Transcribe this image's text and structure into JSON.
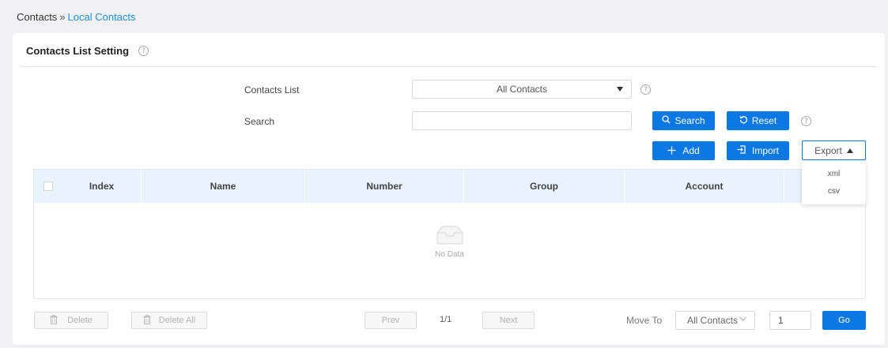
{
  "breadcrumb": {
    "parent": "Contacts",
    "separator": "»",
    "current": "Local Contacts"
  },
  "card": {
    "title": "Contacts List Setting"
  },
  "help_glyph": "?",
  "form": {
    "contacts_list_label": "Contacts List",
    "contacts_list_value": "All Contacts",
    "search_label": "Search",
    "search_value": ""
  },
  "buttons": {
    "search": "Search",
    "reset": "Reset",
    "add": "Add",
    "import": "Import",
    "export": "Export"
  },
  "export_menu": [
    "xml",
    "csv"
  ],
  "table": {
    "columns": [
      "Index",
      "Name",
      "Number",
      "Group",
      "Account"
    ],
    "empty_text": "No Data"
  },
  "footer": {
    "delete": "Delete",
    "delete_all": "Delete All",
    "prev": "Prev",
    "page": "1/1",
    "next": "Next",
    "move_to_label": "Move To",
    "move_to_value": "All Contacts",
    "page_input": "1",
    "go": "Go"
  },
  "colors": {
    "primary": "#0c78e4",
    "link": "#1d8fe1",
    "header_bg": "#e9f3fd"
  }
}
